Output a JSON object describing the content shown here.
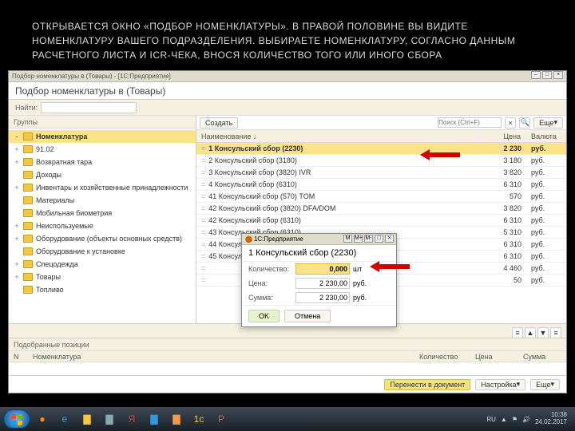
{
  "caption": "ОТКРЫВАЕТСЯ ОКНО «ПОДБОР НОМЕНКЛАТУРЫ». В ПРАВОЙ ПОЛОВИНЕ ВЫ ВИДИТЕ НОМЕНКЛАТУРУ ВАШЕГО ПОДРАЗДЕЛЕНИЯ. ВЫБИРАЕТЕ НОМЕНКЛАТУРУ, СОГЛАСНО ДАННЫМ РАСЧЕТНОГО ЛИСТА И ICR-ЧЕКА, ВНОСЯ КОЛИЧЕСТВО ТОГО ИЛИ ИНОГО СБОРА",
  "window": {
    "app_title": "Подбор номенклатуры в  (Товары) - [1С:Предприятие]",
    "main_title": "Подбор номенклатуры в  (Товары)",
    "search_label": "Найти:",
    "groups_label": "Группы",
    "selected_label": "Подобранные позиции",
    "create_btn": "Создать",
    "more_btn": "Еще",
    "settings_btn": "Настройка",
    "transfer_btn": "Перенести в документ",
    "search_placeholder": "Поиск (Ctrl+F)"
  },
  "tree": [
    {
      "pm": "-",
      "label": "Номенклатура",
      "sel": true
    },
    {
      "pm": "+",
      "label": "91.02"
    },
    {
      "pm": "+",
      "label": "Возвратная тара"
    },
    {
      "pm": "",
      "label": "Доходы"
    },
    {
      "pm": "+",
      "label": "Инвентарь и хозяйственные принадлежности"
    },
    {
      "pm": "",
      "label": "Материалы"
    },
    {
      "pm": "",
      "label": "Мобильная биометрия"
    },
    {
      "pm": "+",
      "label": "Неиспользуемые"
    },
    {
      "pm": "+",
      "label": "Оборудование (объекты основных средств)"
    },
    {
      "pm": "",
      "label": "Оборудование к установке"
    },
    {
      "pm": "+",
      "label": "Спецодежда"
    },
    {
      "pm": "+",
      "label": "Товары"
    },
    {
      "pm": "",
      "label": "Топливо"
    }
  ],
  "cols": {
    "name": "Наименование",
    "price": "Цена",
    "cur": "Валюта",
    "n": "N",
    "nom": "Номенклатура",
    "qty": "Количество",
    "sum": "Сумма"
  },
  "items": [
    {
      "name": "1 Консульский сбор  (2230)",
      "price": "2 230",
      "cur": "руб.",
      "sel": true
    },
    {
      "name": "2 Консульский сбор  (3180)",
      "price": "3 180",
      "cur": "руб."
    },
    {
      "name": "3 Консульский сбор  (3820) IVR",
      "price": "3 820",
      "cur": "руб."
    },
    {
      "name": "4 Консульский сбор  (6310)",
      "price": "6 310",
      "cur": "руб."
    },
    {
      "name": "41 Консульский сбор (570) TOM",
      "price": "570",
      "cur": "руб."
    },
    {
      "name": "42 Консульский сбор (3820) DFA/DOM",
      "price": "3 820",
      "cur": "руб."
    },
    {
      "name": "42 Консульский сбор (6310)",
      "price": "6 310",
      "cur": "руб."
    },
    {
      "name": "43 Консульский сбор (6310)",
      "price": "5 310",
      "cur": "руб."
    },
    {
      "name": "44 Консульский сбор (6310)",
      "price": "6 310",
      "cur": "руб."
    },
    {
      "name": "45 Консульский сбор (6310)",
      "price": "6 310",
      "cur": "руб."
    },
    {
      "name": "",
      "price": "4 460",
      "cur": "руб."
    },
    {
      "name": "",
      "price": "50",
      "cur": "руб."
    }
  ],
  "popup": {
    "app": "1С:Предприятие",
    "title": "1 Консульский сбор  (2230)",
    "qty_label": "Количество:",
    "qty": "0,000",
    "unit": "шт",
    "price_label": "Цена:",
    "price": "2 230,00",
    "cur": "руб.",
    "sum_label": "Сумма:",
    "sum": "2 230,00",
    "ok": "OK",
    "cancel": "Отмена"
  },
  "taskbar": {
    "lang": "RU",
    "time": "10:38",
    "date": "24.02.2017"
  }
}
